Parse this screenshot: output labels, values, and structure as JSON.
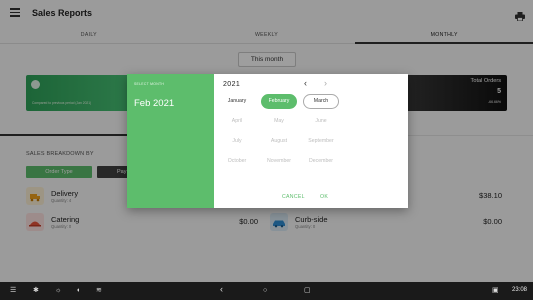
{
  "app": {
    "title": "Sales Reports"
  },
  "tabs": [
    {
      "label": "DAILY",
      "active": false
    },
    {
      "label": "WEEKLY",
      "active": false
    },
    {
      "label": "MONTHLY",
      "active": true
    }
  ],
  "period_selector": {
    "value": "This month"
  },
  "summary_cards": {
    "green_caption": "Compared to previous period (Jan 2021)",
    "total_orders_label": "Total Orders",
    "total_orders_value": "5",
    "total_orders_change": "-66.66%"
  },
  "subtabs": {
    "right_partial": "tory"
  },
  "breakdown": {
    "label": "SALES BREAKDOWN BY",
    "order_type_chip": "Order Type",
    "payment_chip": "Pay"
  },
  "order_types": [
    {
      "name": "Delivery",
      "quantity": "Quantity: 4",
      "amount": "",
      "icon": "delivery-icon"
    },
    {
      "name": "",
      "quantity": "",
      "amount": "$38.10",
      "icon": ""
    },
    {
      "name": "Catering",
      "quantity": "Quantity: 0",
      "amount": "$0.00",
      "icon": "catering-icon"
    },
    {
      "name": "Curb-side",
      "quantity": "Quantity: 0",
      "amount": "$0.00",
      "icon": "car-icon"
    }
  ],
  "month_picker": {
    "caption": "SELECT MONTH",
    "selected_display": "Feb 2021",
    "year": "2021",
    "months": [
      {
        "label": "January",
        "state": "enabled"
      },
      {
        "label": "February",
        "state": "selected"
      },
      {
        "label": "March",
        "state": "current"
      },
      {
        "label": "April",
        "state": "disabled"
      },
      {
        "label": "May",
        "state": "disabled"
      },
      {
        "label": "June",
        "state": "disabled"
      },
      {
        "label": "July",
        "state": "disabled"
      },
      {
        "label": "August",
        "state": "disabled"
      },
      {
        "label": "September",
        "state": "disabled"
      },
      {
        "label": "October",
        "state": "disabled"
      },
      {
        "label": "November",
        "state": "disabled"
      },
      {
        "label": "December",
        "state": "disabled"
      }
    ],
    "cancel_label": "CANCEL",
    "ok_label": "OK"
  },
  "system_bar": {
    "time": "23:08"
  },
  "colors": {
    "accent": "#5dbd6c",
    "dark_card": "#1f1f1f",
    "nav_bar": "#1a1a1a"
  }
}
